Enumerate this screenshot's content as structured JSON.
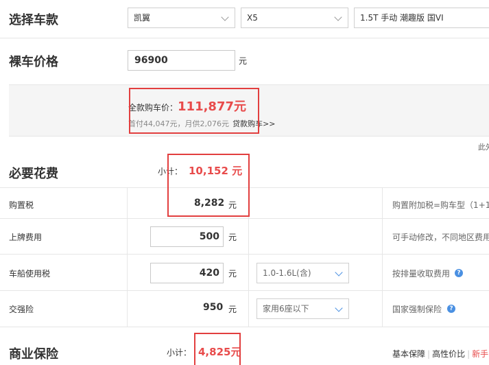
{
  "select_car": {
    "title": "选择车款",
    "brand": "凯翼",
    "model": "X5",
    "version": "1.5T 手动 潮趣版 国VI"
  },
  "bare_price": {
    "title": "裸车价格",
    "value": "96900",
    "unit": "元"
  },
  "summary": {
    "full_label": "全款购车价：",
    "full_value": "111,877元",
    "loan_info": "首付44,047元，月供2,076元",
    "loan_link": "贷款购车>>",
    "note": "此外"
  },
  "required": {
    "title": "必要花费",
    "subtotal_label": "小计：",
    "subtotal_value": "10,152 元",
    "rows": [
      {
        "label": "购置税",
        "value": "8,282",
        "unit": "元",
        "note": "购置附加税=购车型（1+1"
      },
      {
        "label": "上牌费用",
        "value": "500",
        "unit": "元",
        "note": "可手动修改，不同地区费用"
      },
      {
        "label": "车船使用税",
        "value": "420",
        "unit": "元",
        "option": "1.0-1.6L(含)",
        "note": "按排量收取费用"
      },
      {
        "label": "交强险",
        "value": "950",
        "unit": "元",
        "option": "家用6座以下",
        "note": "国家强制保险"
      }
    ]
  },
  "insurance": {
    "title": "商业保险",
    "subtotal_label": "小计：",
    "subtotal_value": "4,825元",
    "tabs": [
      "基本保障",
      "高性价比",
      "新手"
    ]
  },
  "colors": {
    "accent_red": "#e84b4b",
    "highlight_box": "#e23e3e",
    "help_blue": "#4a90e2"
  }
}
